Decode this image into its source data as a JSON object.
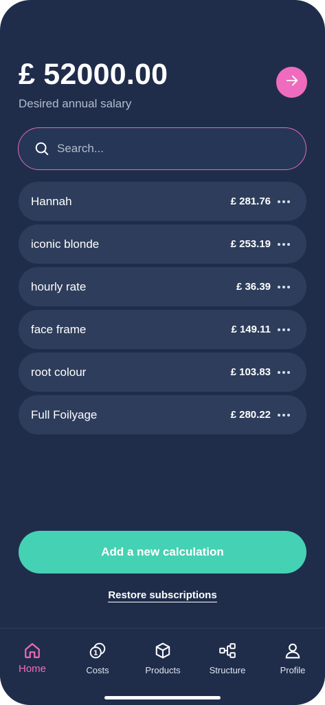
{
  "header": {
    "salary": "£ 52000.00",
    "caption": "Desired annual salary"
  },
  "search": {
    "placeholder": "Search..."
  },
  "calculations": [
    {
      "name": "Hannah",
      "price": "£ 281.76"
    },
    {
      "name": "iconic blonde",
      "price": "£ 253.19"
    },
    {
      "name": "hourly rate",
      "price": "£ 36.39"
    },
    {
      "name": "face frame",
      "price": "£ 149.11"
    },
    {
      "name": "root colour",
      "price": "£ 103.83"
    },
    {
      "name": "Full Foilyage",
      "price": "£ 280.22"
    }
  ],
  "actions": {
    "add_label": "Add a new calculation",
    "restore_label": "Restore subscriptions"
  },
  "tabbar": {
    "tabs": [
      {
        "label": "Home",
        "icon": "home-icon",
        "active": true
      },
      {
        "label": "Costs",
        "icon": "coins-icon",
        "active": false
      },
      {
        "label": "Products",
        "icon": "box-icon",
        "active": false
      },
      {
        "label": "Structure",
        "icon": "structure-icon",
        "active": false
      },
      {
        "label": "Profile",
        "icon": "user-icon",
        "active": false
      }
    ]
  },
  "colors": {
    "background": "#1f2d4b",
    "accent_pink": "#ef6bbd",
    "accent_teal": "#45d1b3",
    "row_bg": "#2e3d5b"
  }
}
